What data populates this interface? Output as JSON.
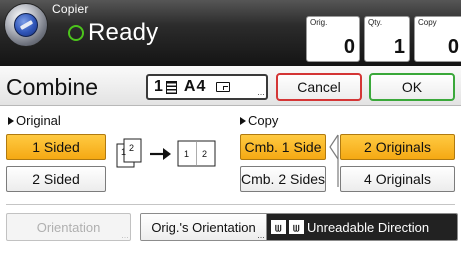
{
  "header": {
    "app_title": "Copier",
    "status": "Ready",
    "counters": {
      "orig_label": "Orig.",
      "orig_value": "0",
      "qty_label": "Qty.",
      "qty_value": "1",
      "copy_label": "Copy",
      "copy_value": "0"
    }
  },
  "title_row": {
    "title": "Combine",
    "paper_tray": "1",
    "paper_size": "A4",
    "cancel_label": "Cancel",
    "ok_label": "OK"
  },
  "original": {
    "section_label": "Original",
    "options": [
      "1 Sided",
      "2 Sided"
    ],
    "selected": "1 Sided"
  },
  "diagram": {
    "source_pages": [
      "1",
      "2"
    ],
    "result_pages": [
      "1",
      "2"
    ]
  },
  "copy": {
    "section_label": "Copy",
    "options": [
      "Cmb. 1 Side",
      "Cmb. 2 Sides"
    ],
    "selected": "Cmb. 1 Side",
    "originals_options": [
      "2 Originals",
      "4 Originals"
    ],
    "originals_selected": "2 Originals"
  },
  "bottom": {
    "orientation_label": "Orientation",
    "orig_orientation_label": "Orig.'s Orientation",
    "orientation_value": "Unreadable Direction"
  },
  "colors": {
    "selected": "#f5a913",
    "ready_indicator": "#4cc41c",
    "cancel_border": "#d43535",
    "ok_border": "#3aa83a"
  }
}
